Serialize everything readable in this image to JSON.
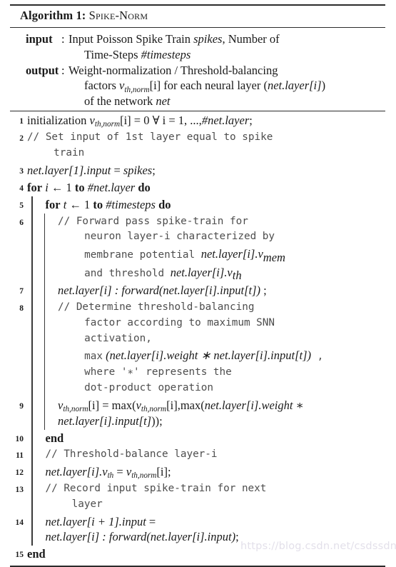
{
  "caption": {
    "prefix": "Algorithm 1:",
    "name": "Spike-Norm"
  },
  "io": {
    "input_label": "input",
    "input_colon": ":",
    "input_line1_a": "Input Poisson Spike Train ",
    "input_line1_it": "spikes",
    "input_line1_b": ", Number of",
    "input_line2_a": "Time-Steps ",
    "input_line2_it": "#timesteps",
    "output_label": "output",
    "output_colon": ":",
    "output_line1": "Weight-normalization / Threshold-balancing",
    "output_line2_a": "factors ",
    "output_line2_v": "v",
    "output_line2_sub": "th,norm",
    "output_line2_b": "[i] for each neural layer (",
    "output_line2_it": "net.layer[i]",
    "output_line2_c": ")",
    "output_line3_a": "of the network ",
    "output_line3_it": "net"
  },
  "lines": {
    "n1": "1",
    "n2": "2",
    "n3": "3",
    "n4": "4",
    "n5": "5",
    "n6": "6",
    "n7": "7",
    "n8": "8",
    "n9": "9",
    "n10": "10",
    "n11": "11",
    "n12": "12",
    "n13": "13",
    "n14": "14",
    "n15": "15"
  },
  "body": {
    "l1_a": "initialization ",
    "l1_v": "v",
    "l1_sub": "th,norm",
    "l1_b": "[i] = 0 ∀ i = 1, ...,",
    "l1_it": "#net.layer",
    "l1_c": ";",
    "l2_comment_1": "// Set input of 1st layer equal to spike",
    "l2_comment_2": "train",
    "l3_it": "net.layer[1].input",
    "l3_eq": " = ",
    "l3_it2": "spikes",
    "l3_end": ";",
    "l4_for": "for",
    "l4_var": " i ",
    "l4_arrow": "← 1 ",
    "l4_to": "to ",
    "l4_bound": "#net.layer",
    "l4_do": " do",
    "l5_for": "for",
    "l5_var": " t ",
    "l5_arrow": "← 1 ",
    "l5_to": "to ",
    "l5_bound": "#timesteps",
    "l5_do": " do",
    "l6_c1": "// Forward pass spike-train for",
    "l6_c2": "neuron layer-i characterized by",
    "l6_c3_a": "membrane potential ",
    "l6_c3_it": "net.layer[i].v",
    "l6_c3_sub": "mem",
    "l6_c4_a": "and threshold ",
    "l6_c4_it": "net.layer[i].v",
    "l6_c4_sub": "th",
    "l7_it": "net.layer[i] : forward(net.layer[i].input[t])",
    "l7_end": " ;",
    "l8_c1": "// Determine threshold-balancing",
    "l8_c2": "factor according to maximum SNN",
    "l8_c3": "activation,",
    "l8_c4_mono": "max",
    "l8_c4_it": " (net.layer[i].weight ∗ net.layer[i].input[t])",
    "l8_c4_tail": " ,",
    "l8_c5": "where '∗' represents the",
    "l8_c6": "dot-product operation",
    "l9_v": "v",
    "l9_sub": "th,norm",
    "l9_a": "[i] = max(",
    "l9_v2": "v",
    "l9_sub2": "th,norm",
    "l9_b": "[i],max(",
    "l9_it": "net.layer[i].weight",
    "l9_c": " ∗",
    "l9_line2_it": "net.layer[i].input[t]",
    "l9_line2_end": "));",
    "l10_end": "end",
    "l11_comment": "// Threshold-balance layer-i",
    "l12_it": "net.layer[i].v",
    "l12_sub": "th",
    "l12_eq": " = ",
    "l12_v": "v",
    "l12_sub2": "th,norm",
    "l12_end": "[i];",
    "l13_c1": "// Record input spike-train for next",
    "l13_c2": "layer",
    "l14_it": "net.layer[i + 1].input",
    "l14_eq": " =",
    "l14_line2_it": "net.layer[i] : forward(net.layer[i].input)",
    "l14_line2_end": ";",
    "l15_end": "end"
  },
  "watermark": "https://blog.csdn.net/csdssdn"
}
